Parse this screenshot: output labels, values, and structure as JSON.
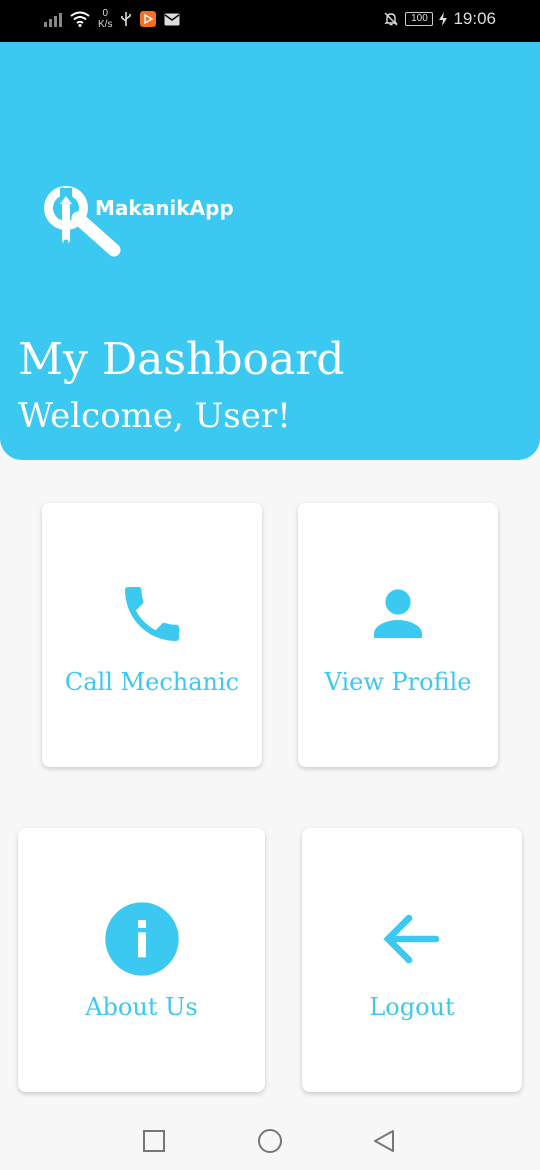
{
  "status_bar": {
    "net_speed_value": "0",
    "net_speed_unit": "K/s",
    "battery": "100",
    "time": "19:06"
  },
  "header": {
    "app_name": "MakanikApp",
    "title": "My Dashboard",
    "subtitle": "Welcome, User!"
  },
  "cards": {
    "call": {
      "label": "Call Mechanic",
      "icon": "phone-icon"
    },
    "profile": {
      "label": "View Profile",
      "icon": "person-icon"
    },
    "about": {
      "label": "About Us",
      "icon": "info-icon"
    },
    "logout": {
      "label": "Logout",
      "icon": "arrow-left-icon"
    }
  },
  "nav": {
    "buttons": [
      "recents-button",
      "home-button",
      "back-button"
    ]
  },
  "colors": {
    "accent": "#3bc9f1",
    "background": "#f7f7f7",
    "card": "#ffffff"
  }
}
